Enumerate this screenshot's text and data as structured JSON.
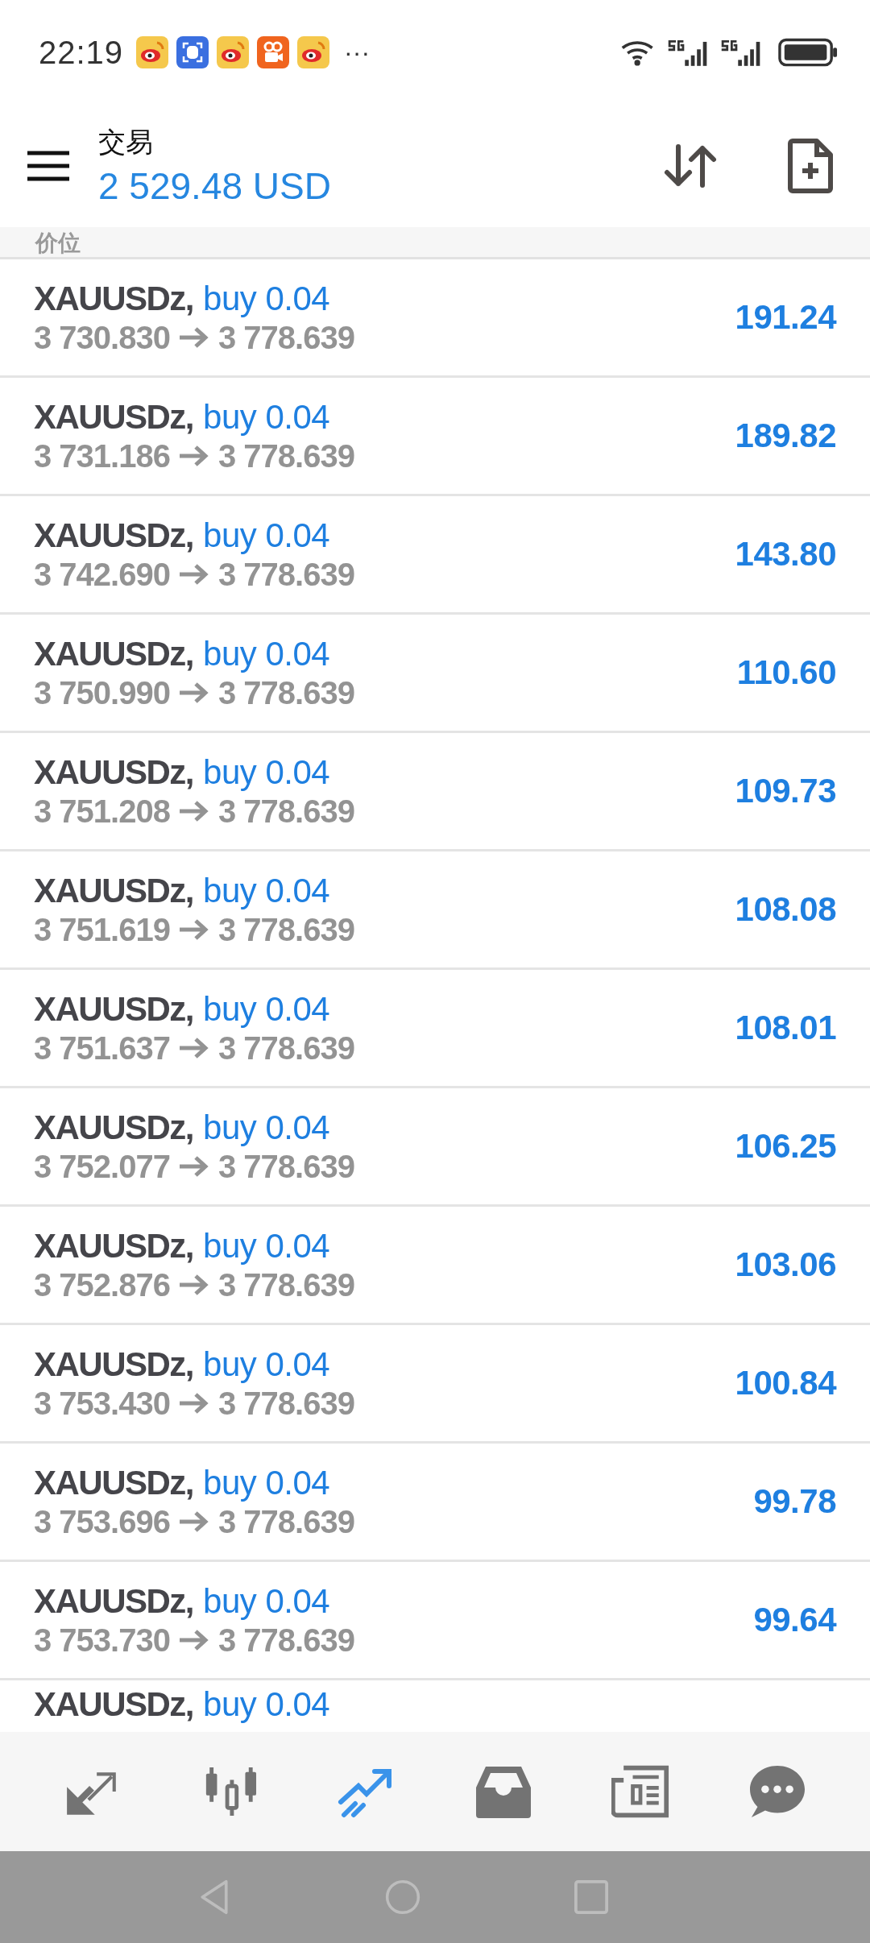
{
  "status_bar": {
    "time": "22:19",
    "notification_icons": [
      {
        "kind": "weibo"
      },
      {
        "kind": "face"
      },
      {
        "kind": "weibo"
      },
      {
        "kind": "video"
      },
      {
        "kind": "weibo"
      }
    ],
    "more": "···"
  },
  "header": {
    "title": "交易",
    "balance": "2 529.48 USD"
  },
  "section": {
    "label": "价位"
  },
  "positions": [
    {
      "symbol": "XAUUSDz,",
      "order": "buy 0.04",
      "open_price": "3 730.830",
      "current_price": "3 778.639",
      "profit": "191.24"
    },
    {
      "symbol": "XAUUSDz,",
      "order": "buy 0.04",
      "open_price": "3 731.186",
      "current_price": "3 778.639",
      "profit": "189.82"
    },
    {
      "symbol": "XAUUSDz,",
      "order": "buy 0.04",
      "open_price": "3 742.690",
      "current_price": "3 778.639",
      "profit": "143.80"
    },
    {
      "symbol": "XAUUSDz,",
      "order": "buy 0.04",
      "open_price": "3 750.990",
      "current_price": "3 778.639",
      "profit": "110.60"
    },
    {
      "symbol": "XAUUSDz,",
      "order": "buy 0.04",
      "open_price": "3 751.208",
      "current_price": "3 778.639",
      "profit": "109.73"
    },
    {
      "symbol": "XAUUSDz,",
      "order": "buy 0.04",
      "open_price": "3 751.619",
      "current_price": "3 778.639",
      "profit": "108.08"
    },
    {
      "symbol": "XAUUSDz,",
      "order": "buy 0.04",
      "open_price": "3 751.637",
      "current_price": "3 778.639",
      "profit": "108.01"
    },
    {
      "symbol": "XAUUSDz,",
      "order": "buy 0.04",
      "open_price": "3 752.077",
      "current_price": "3 778.639",
      "profit": "106.25"
    },
    {
      "symbol": "XAUUSDz,",
      "order": "buy 0.04",
      "open_price": "3 752.876",
      "current_price": "3 778.639",
      "profit": "103.06"
    },
    {
      "symbol": "XAUUSDz,",
      "order": "buy 0.04",
      "open_price": "3 753.430",
      "current_price": "3 778.639",
      "profit": "100.84"
    },
    {
      "symbol": "XAUUSDz,",
      "order": "buy 0.04",
      "open_price": "3 753.696",
      "current_price": "3 778.639",
      "profit": "99.78"
    },
    {
      "symbol": "XAUUSDz,",
      "order": "buy 0.04",
      "open_price": "3 753.730",
      "current_price": "3 778.639",
      "profit": "99.64"
    },
    {
      "symbol": "XAUUSDz,",
      "order": "buy 0.04"
    }
  ],
  "bottom_nav": [
    {
      "kind": "quotes",
      "selected": false
    },
    {
      "kind": "chart",
      "selected": false
    },
    {
      "kind": "trade",
      "selected": true
    },
    {
      "kind": "history",
      "selected": false
    },
    {
      "kind": "news",
      "selected": false
    },
    {
      "kind": "messages",
      "selected": false
    }
  ]
}
